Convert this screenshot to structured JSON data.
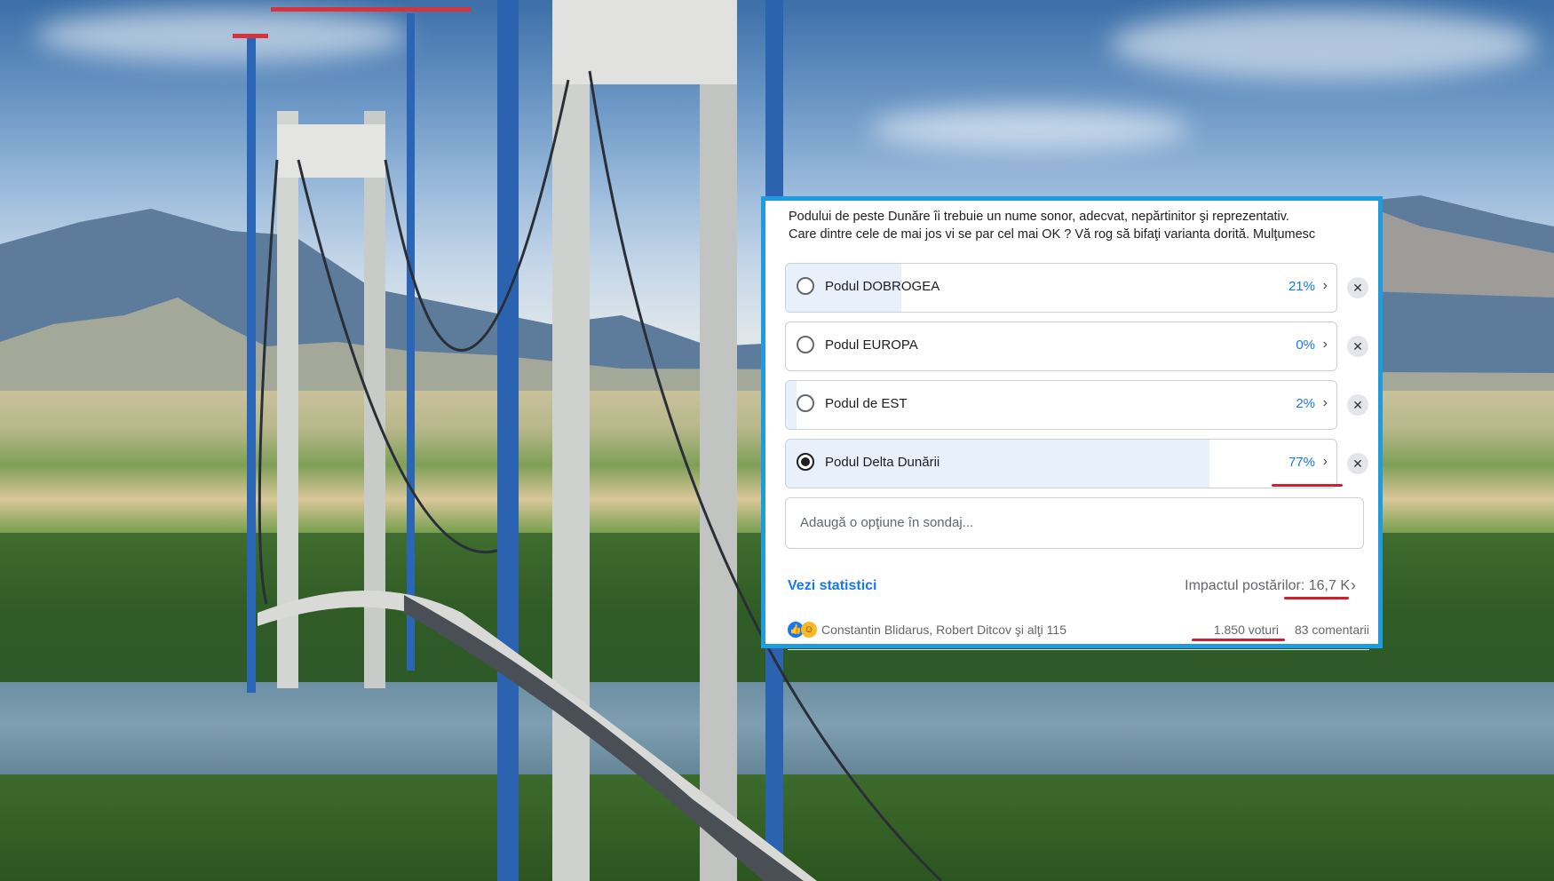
{
  "poll": {
    "question_lines": [
      "Podului de peste Dunăre îi trebuie un nume sonor, adecvat, nepărtinitor şi reprezentativ.",
      "Care dintre cele de mai jos vi se par cel mai OK ? Vă rog să bifaţi varianta dorită. Mulţumesc"
    ],
    "options": [
      {
        "label": "Podul DOBROGEA",
        "percent": "21%",
        "share": 0.21,
        "selected": false
      },
      {
        "label": "Podul EUROPA",
        "percent": "0%",
        "share": 0.0,
        "selected": false
      },
      {
        "label": "Podul de EST",
        "percent": "2%",
        "share": 0.02,
        "selected": false
      },
      {
        "label": "Podul Delta Dunării",
        "percent": "77%",
        "share": 0.77,
        "selected": true
      }
    ],
    "add_option_placeholder": "Adaugă o opţiune în sondaj...",
    "stats_link": "Vezi statistici",
    "impact_label": "Impactul postărilor: ",
    "impact_value": "16,7 K",
    "reactors": "Constantin Blidarus, Robert Ditcov şi alţi 115",
    "votes": "1.850 voturi",
    "comments": "83 comentarii"
  },
  "icons": {
    "chevron": "chevron-right-icon",
    "remove": "close-icon",
    "like": "like-reaction-icon",
    "haha": "haha-reaction-icon"
  },
  "colors": {
    "card_border": "#1f9be0",
    "accent": "#1877f2",
    "bar_fill": "#e7f0fb",
    "highlight_underline": "#d0202e"
  }
}
